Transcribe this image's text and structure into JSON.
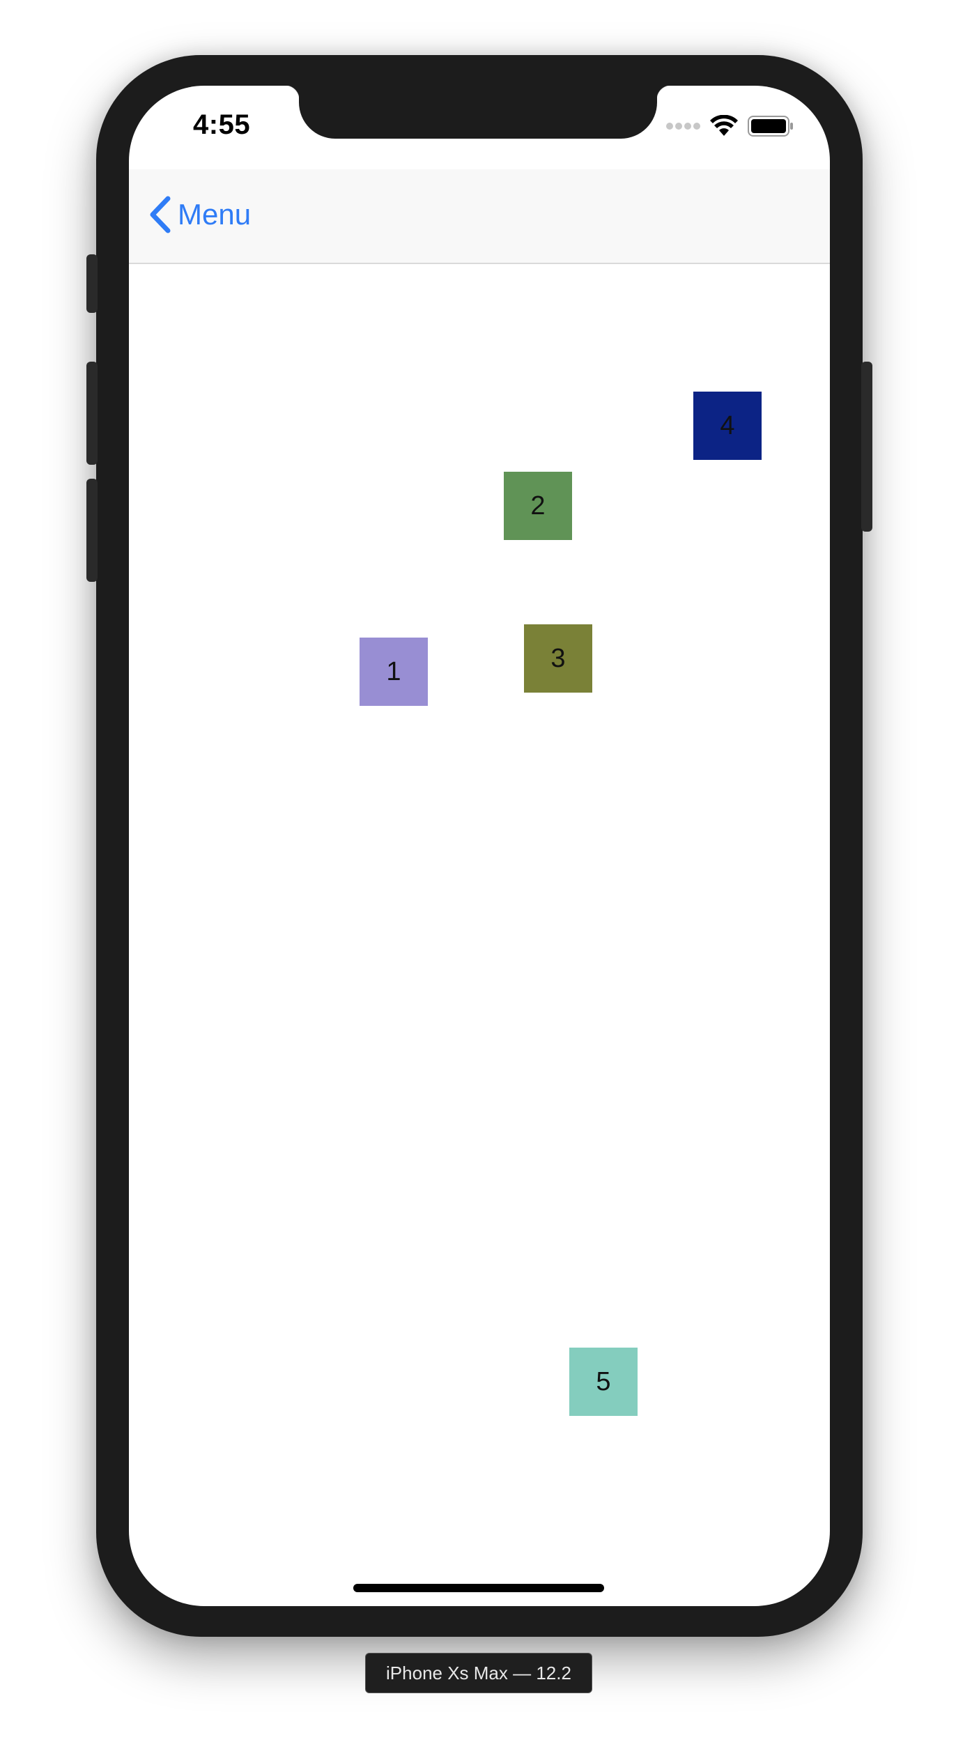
{
  "status_bar": {
    "time": "4:55",
    "icons": [
      "signal-dots-icon",
      "wifi-icon",
      "battery-icon"
    ]
  },
  "navbar": {
    "back_label": "Menu",
    "back_icon": "chevron-left-icon"
  },
  "colors": {
    "accent": "#2f7cf6",
    "device_frame": "#1c1c1c"
  },
  "squares": [
    {
      "label": "1",
      "color": "#988ed3"
    },
    {
      "label": "2",
      "color": "#609356"
    },
    {
      "label": "3",
      "color": "#7a8137"
    },
    {
      "label": "4",
      "color": "#0c2385"
    },
    {
      "label": "5",
      "color": "#84cdbe"
    }
  ],
  "simulator": {
    "device_label": "iPhone Xs Max — 12.2"
  }
}
